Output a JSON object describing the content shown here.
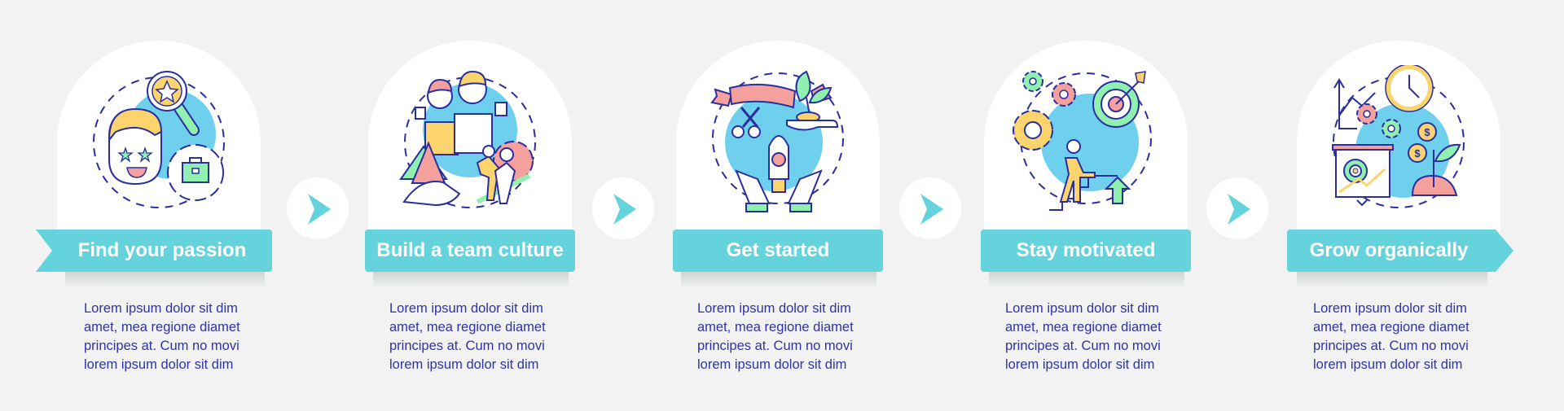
{
  "colors": {
    "background": "#f2f2f2",
    "card": "#ffffff",
    "accent": "#64d3dc",
    "text": "#2e33a8",
    "icon_blue": "#6fd0ee",
    "icon_yellow": "#fbd46d",
    "icon_pink": "#f4a09c",
    "icon_green": "#8ff0b0",
    "icon_outline": "#2a2e9e"
  },
  "steps": [
    {
      "title": "Find your passion",
      "icon": "passion-icon",
      "description": [
        "Lorem ipsum dolor sit dim",
        "amet, mea regione diamet",
        "principes at. Cum no movi",
        "lorem ipsum dolor sit dim"
      ]
    },
    {
      "title": "Build a team culture",
      "icon": "team-culture-icon",
      "description": [
        "Lorem ipsum dolor sit dim",
        "amet, mea regione diamet",
        "principes at. Cum no movi",
        "lorem ipsum dolor sit dim"
      ]
    },
    {
      "title": "Get started",
      "icon": "get-started-icon",
      "description": [
        "Lorem ipsum dolor sit dim",
        "amet, mea regione diamet",
        "principes at. Cum no movi",
        "lorem ipsum dolor sit dim"
      ]
    },
    {
      "title": "Stay motivated",
      "icon": "stay-motivated-icon",
      "description": [
        "Lorem ipsum dolor sit dim",
        "amet, mea regione diamet",
        "principes at. Cum no movi",
        "lorem ipsum dolor sit dim"
      ]
    },
    {
      "title": "Grow organically",
      "icon": "grow-organically-icon",
      "description": [
        "Lorem ipsum dolor sit dim",
        "amet, mea regione diamet",
        "principes at. Cum no movi",
        "lorem ipsum dolor sit dim"
      ]
    }
  ],
  "connectors": [
    "chevron-right-icon",
    "chevron-right-icon",
    "chevron-right-icon",
    "chevron-right-icon"
  ]
}
